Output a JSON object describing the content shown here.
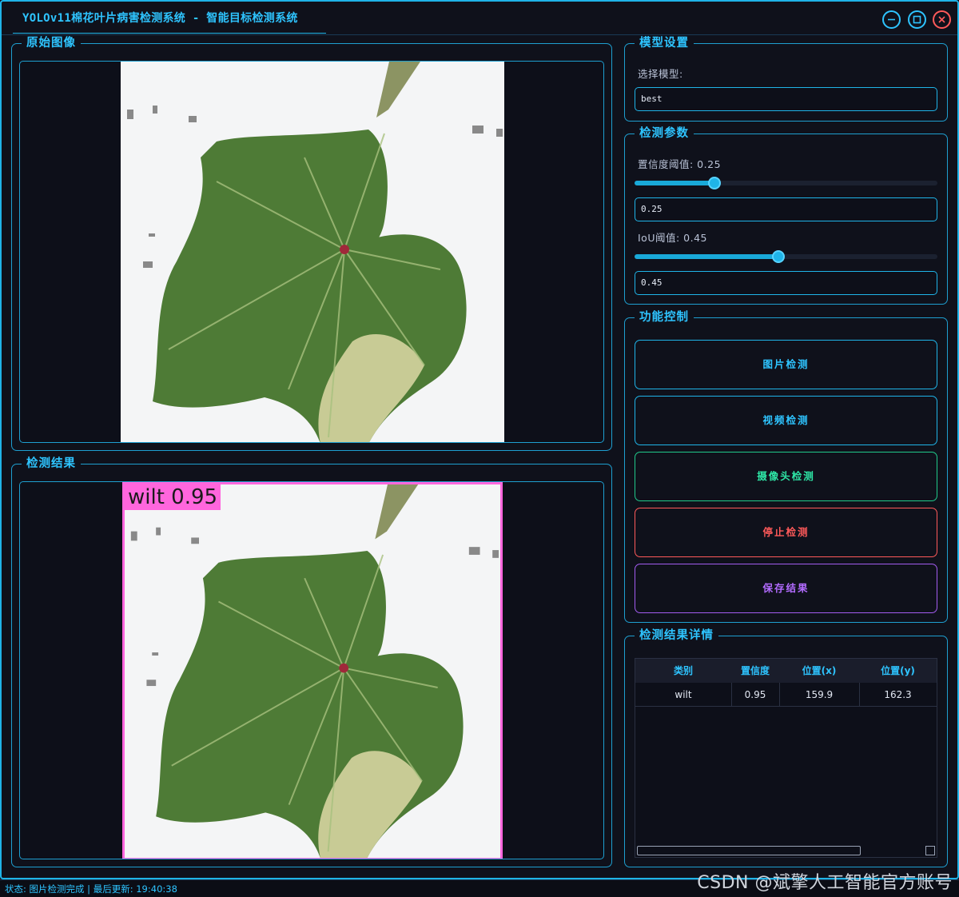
{
  "window": {
    "title": "YOLOv11棉花叶片病害检测系统 - 智能目标检测系统"
  },
  "panels": {
    "original_title": "原始图像",
    "result_title": "检测结果",
    "detection_label": "wilt 0.95"
  },
  "model_settings": {
    "title": "模型设置",
    "select_label": "选择模型:",
    "selected_model": "best"
  },
  "detect_params": {
    "title": "检测参数",
    "conf_label": "置信度阈值: 0.25",
    "conf_value": "0.25",
    "conf_level": 0.25,
    "iou_label": "IoU阈值: 0.45",
    "iou_value": "0.45",
    "iou_level": 0.45
  },
  "controls": {
    "title": "功能控制",
    "image_detect": "图片检测",
    "video_detect": "视频检测",
    "camera_detect": "摄像头检测",
    "stop_detect": "停止检测",
    "save_result": "保存结果"
  },
  "results": {
    "title": "检测结果详情",
    "columns": [
      "类别",
      "置信度",
      "位置(x)",
      "位置(y)"
    ],
    "rows": [
      [
        "wilt",
        "0.95",
        "159.9",
        "162.3"
      ]
    ]
  },
  "status": "状态: 图片检测完成 | 最后更新: 19:40:38",
  "watermark": "CSDN @斌擎人工智能官方账号",
  "colors": {
    "accent": "#2ec4ff",
    "camera": "#2ee6a6",
    "stop": "#ff5a5a",
    "save": "#b26bff",
    "detection_box": "#ff66dd"
  }
}
